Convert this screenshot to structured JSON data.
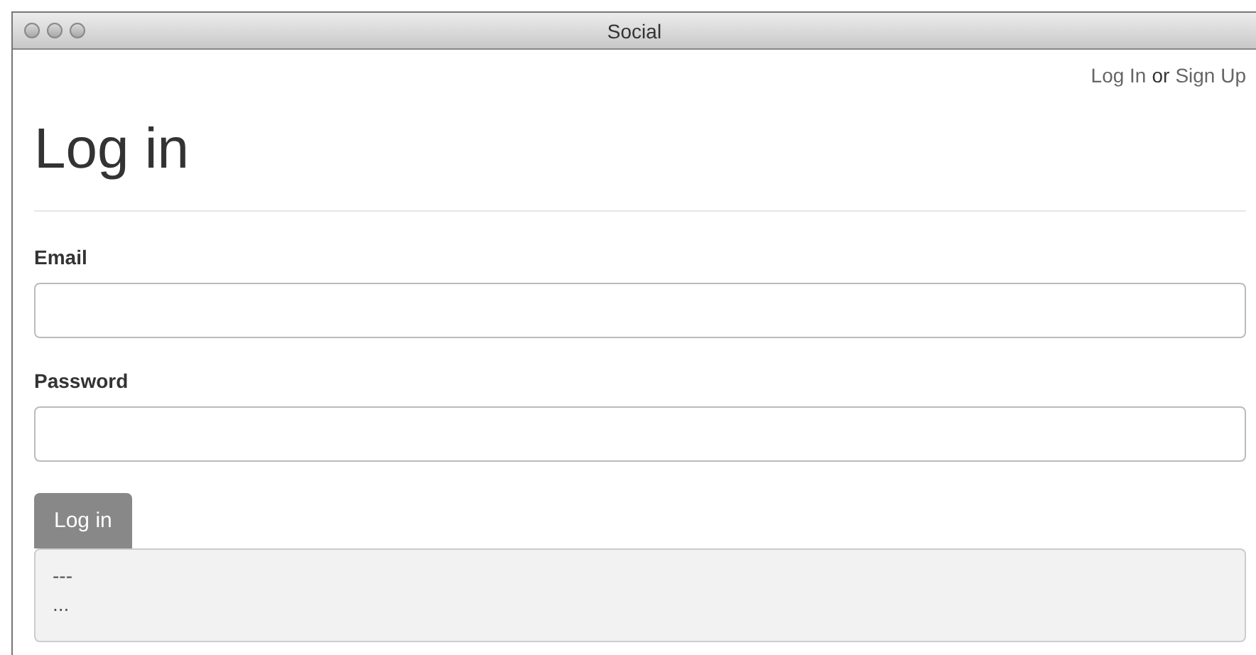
{
  "window": {
    "title": "Social"
  },
  "nav": {
    "login_link": "Log In",
    "separator": "or",
    "signup_link": "Sign Up"
  },
  "heading": "Log in",
  "fields": [
    {
      "label": "Email"
    },
    {
      "label": "Password"
    }
  ],
  "submit_button": "Log in",
  "output": [
    "---",
    "..."
  ]
}
